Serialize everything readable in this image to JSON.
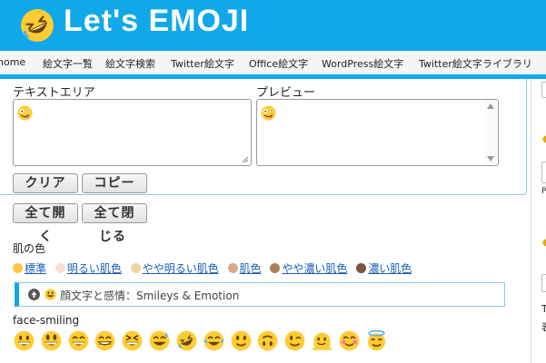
{
  "header": {
    "logo_text": "Let's EMOJI",
    "logo_icon": "rolling-on-floor-laughing-emoji"
  },
  "nav": {
    "items": [
      "home",
      "絵文字一覧",
      "絵文字検索",
      "Twitter絵文字",
      "Office絵文字",
      "WordPress絵文字",
      "Twitter絵文字ライブラリ"
    ]
  },
  "editor": {
    "textarea_label": "テキストエリア",
    "preview_label": "プレビュー",
    "textarea_value_icon": "zany-face-emoji",
    "preview_value_icon": "zany-face-emoji",
    "clear_button": "クリア",
    "copy_button": "コピー"
  },
  "controls": {
    "expand_all_line1": "全て開",
    "expand_all_line2": "く",
    "collapse_all_line1": "全て閉",
    "collapse_all_line2": "じる"
  },
  "skin": {
    "label": "肌の色",
    "options": [
      "標準",
      "明るい肌色",
      "やや明るい肌色",
      "肌色",
      "やや濃い肌色",
      "濃い肌色"
    ],
    "colors": [
      "#ffc83d",
      "#f7dece",
      "#f3d2a2",
      "#d5ab88",
      "#af7e57",
      "#7c533e"
    ]
  },
  "section": {
    "title": "顔文字と感情：Smileys & Emotion"
  },
  "subgroup": {
    "title": "face-smiling"
  },
  "emojis": [
    "grinning-face",
    "grinning-face-big-eyes",
    "grinning-face-smiling-eyes",
    "beaming-face",
    "grinning-squinting-face",
    "grinning-face-sweat",
    "rolling-on-floor-laughing",
    "face-tears-of-joy",
    "slightly-smiling-face",
    "upside-down-face",
    "winking-face",
    "melting-face",
    "smiling-face-smiling-eyes",
    "smiling-face-halo"
  ],
  "sidebar": {
    "text_a": "P",
    "text_b": "T",
    "text_c": "表"
  },
  "colors": {
    "brand": "#10a8e8",
    "emoji_yellow": "#ffcc33"
  }
}
